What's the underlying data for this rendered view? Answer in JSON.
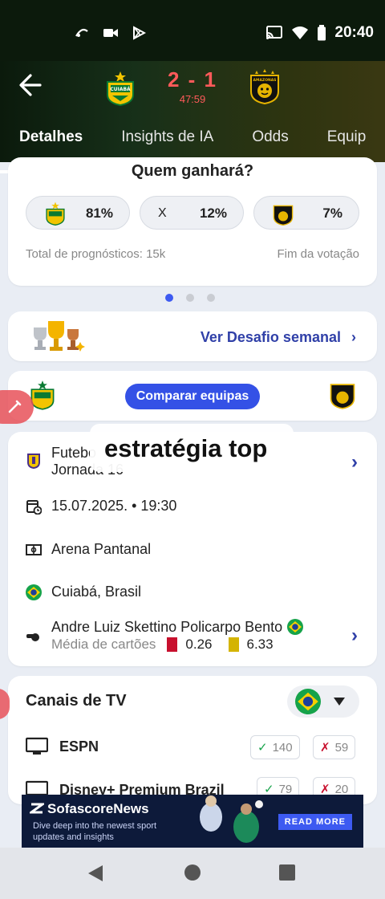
{
  "status_bar": {
    "time": "20:40"
  },
  "header": {
    "score": "2 - 1",
    "clock": "47:59",
    "home_team_logo_text": "CUIABÁ",
    "away_team_logo_text": "AMAZONAS",
    "tabs": [
      {
        "label": "Detalhes",
        "active": true
      },
      {
        "label": "Insights de IA",
        "active": false
      },
      {
        "label": "Odds",
        "active": false
      },
      {
        "label": "Equip",
        "active": false
      }
    ]
  },
  "poll": {
    "title": "Quem ganhará?",
    "home_pct": "81%",
    "draw_label": "X",
    "draw_pct": "12%",
    "away_pct": "7%",
    "total_votes": "Total de prognósticos: 15k",
    "status": "Fim da votação"
  },
  "pager": {
    "count": 3,
    "active_index": 0
  },
  "weekly": {
    "link_label": "Ver Desafio semanal"
  },
  "compare": {
    "button_label": "Comparar equipas"
  },
  "overlay": {
    "text": "estratégia top"
  },
  "match_info": {
    "tournament_line1": "Futebo",
    "tournament_line2": "Jornada 16",
    "datetime": "15.07.2025. • 19:30",
    "venue": "Arena Pantanal",
    "city": "Cuiabá, Brasil",
    "referee": "Andre Luiz Skettino Policarpo Bento",
    "cards_label": "Média de cartões",
    "red_cards": "0.26",
    "yellow_cards": "6.33"
  },
  "tv": {
    "title": "Canais de TV",
    "channels": [
      {
        "name": "ESPN",
        "up": "140",
        "down": "59"
      },
      {
        "name": "Disney+ Premium Brazil",
        "up": "79",
        "down": "20"
      }
    ]
  },
  "ad": {
    "brand": "SofascoreNews",
    "tagline": "Dive deep into the newest sport updates and insights",
    "cta": "READ MORE"
  },
  "colors": {
    "accent": "#3451e6",
    "score_red": "#ff5a5a",
    "link_blue": "#3040a8"
  }
}
